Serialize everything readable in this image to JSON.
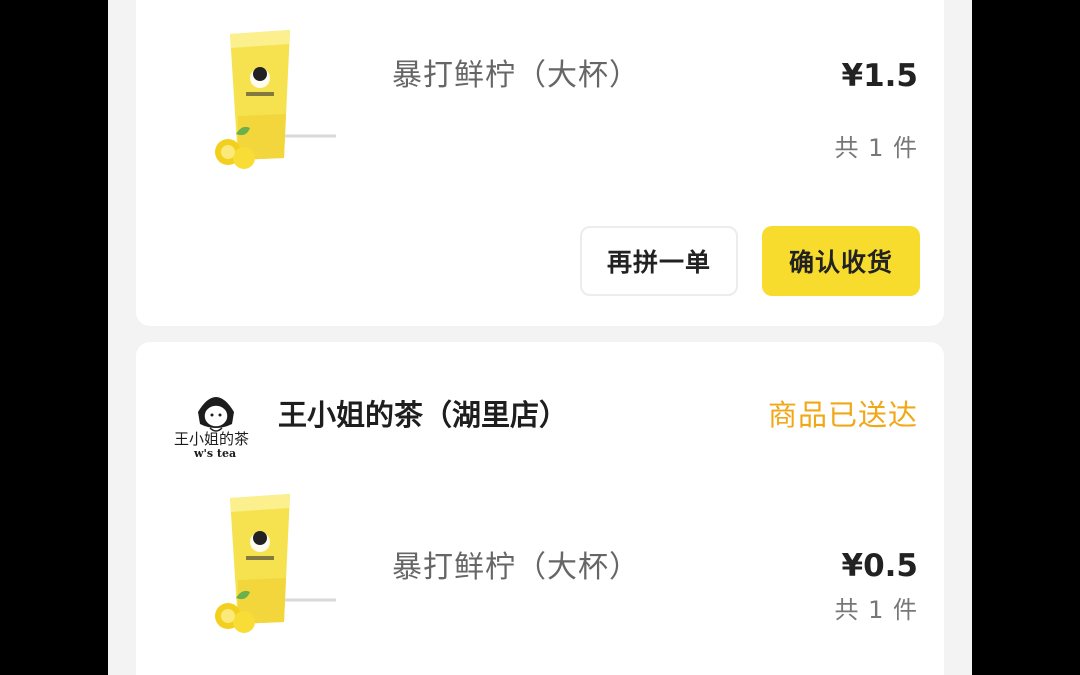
{
  "orders": [
    {
      "product": {
        "name": "暴打鲜柠（大杯）",
        "price": "¥1.5",
        "quantity": "共 1 件",
        "image_icon": "lemon-tea-cup-icon"
      },
      "actions": {
        "reorder_label": "再拼一单",
        "confirm_label": "确认收货"
      }
    },
    {
      "shop": {
        "name": "王小姐的茶（湖里店）",
        "status": "商品已送达",
        "logo_icon": "shop-logo-icon",
        "logo_text": "王小姐的茶 w's tea"
      },
      "product": {
        "name": "暴打鲜柠（大杯）",
        "price": "¥0.5",
        "quantity": "共 1 件",
        "image_icon": "lemon-tea-cup-icon"
      }
    }
  ],
  "colors": {
    "background": "#f3f3f3",
    "card": "#ffffff",
    "accent_button": "#f7dc2e",
    "status_text": "#f0a818"
  }
}
